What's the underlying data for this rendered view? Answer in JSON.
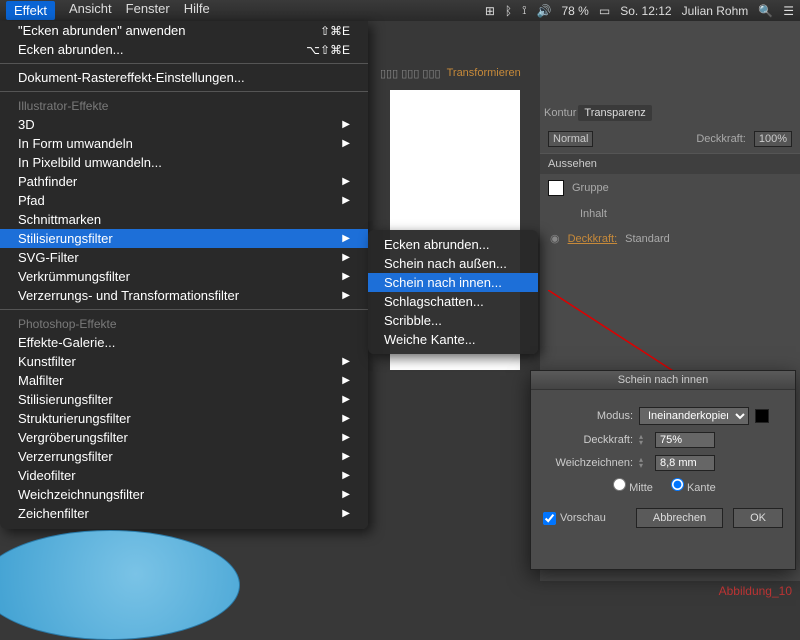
{
  "macbar": {
    "menus": [
      "Effekt",
      "Ansicht",
      "Fenster",
      "Hilfe"
    ],
    "battery": "78 %",
    "time": "So. 12:12",
    "user": "Julian Rohm"
  },
  "user_bar": {
    "name": "Julian Rohm"
  },
  "toolbar": {
    "transform": "Transformieren"
  },
  "dropdown": {
    "apply": "\"Ecken abrunden\" anwenden",
    "apply_sc": "⇧⌘E",
    "ecken": "Ecken abrunden...",
    "ecken_sc": "⌥⇧⌘E",
    "raster": "Dokument-Rastereffekt-Einstellungen...",
    "illu_section": "Illustrator-Effekte",
    "illu_items": [
      "3D",
      "In Form umwandeln",
      "In Pixelbild umwandeln...",
      "Pathfinder",
      "Pfad",
      "Schnittmarken",
      "Stilisierungsfilter",
      "SVG-Filter",
      "Verkrümmungsfilter",
      "Verzerrungs- und Transformationsfilter"
    ],
    "ps_section": "Photoshop-Effekte",
    "ps_items": [
      "Effekte-Galerie...",
      "Kunstfilter",
      "Malfilter",
      "Stilisierungsfilter",
      "Strukturierungsfilter",
      "Vergröberungsfilter",
      "Verzerrungsfilter",
      "Videofilter",
      "Weichzeichnungsfilter",
      "Zeichenfilter"
    ]
  },
  "submenu": {
    "items": [
      "Ecken abrunden...",
      "Schein nach außen...",
      "Schein nach innen...",
      "Schlagschatten...",
      "Scribble...",
      "Weiche Kante..."
    ]
  },
  "right_panel": {
    "tabs": [
      "Kontur",
      "Transparenz"
    ],
    "blend": "Normal",
    "opacity_label": "Deckkraft:",
    "opacity_val": "100%",
    "aussehen": "Aussehen",
    "gruppe": "Gruppe",
    "inhalt": "Inhalt",
    "deck": "Deckkraft:",
    "std": "Standard"
  },
  "dialog": {
    "title": "Schein nach innen",
    "modus": "Modus:",
    "modus_val": "Ineinanderkopieren",
    "deck": "Deckkraft:",
    "deck_val": "75%",
    "weich": "Weichzeichnen:",
    "weich_val": "8,8 mm",
    "mitte": "Mitte",
    "kante": "Kante",
    "vorschau": "Vorschau",
    "cancel": "Abbrechen",
    "ok": "OK"
  },
  "caption": "Abbildung_10"
}
